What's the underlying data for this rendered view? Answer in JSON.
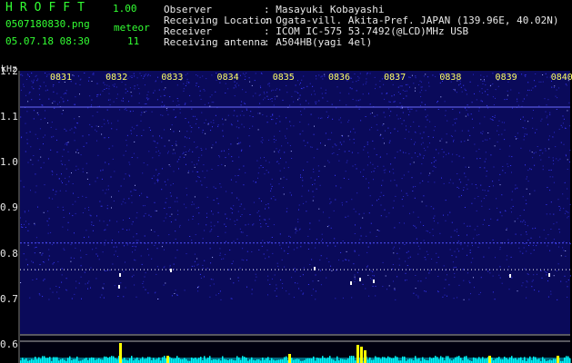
{
  "app": {
    "name": "HROFFT",
    "version": "1.00"
  },
  "file": {
    "name": "0507180830.png",
    "date_time": "05.07.18 08:30"
  },
  "meteor": {
    "label": "meteor",
    "count": "11"
  },
  "info": [
    {
      "key": "Observer",
      "value": ": Masayuki Kobayashi"
    },
    {
      "key": "Receiving Location",
      "value": ": Ogata-vill. Akita-Pref. JAPAN (139.96E, 40.02N)"
    },
    {
      "key": "Receiver",
      "value": ": ICOM IC-575 53.7492(@LCD)MHz USB"
    },
    {
      "key": "Receiving antenna",
      "value": ": A504HB(yagi 4el)"
    }
  ],
  "chart_data": {
    "type": "heatmap",
    "ylabel": "kHz",
    "yticks": [
      "1.2",
      "1.1",
      "1.0",
      "0.9",
      "0.8",
      "0.7",
      "0.6"
    ],
    "ytick_values": [
      1.2,
      1.1,
      1.0,
      0.9,
      0.8,
      0.7,
      0.6
    ],
    "ylim": [
      0.58,
      1.2
    ],
    "xticks": [
      "0831",
      "0832",
      "0833",
      "0834",
      "0835",
      "0836",
      "0837",
      "0838",
      "0839",
      "0840"
    ],
    "colors": {
      "background": "#0a0a5a",
      "noise": "#3a3aff",
      "signal_line": "#ffffff",
      "meteor": "#ffff00",
      "level": "#00ffff",
      "threshold": "#b0b0b0"
    }
  }
}
